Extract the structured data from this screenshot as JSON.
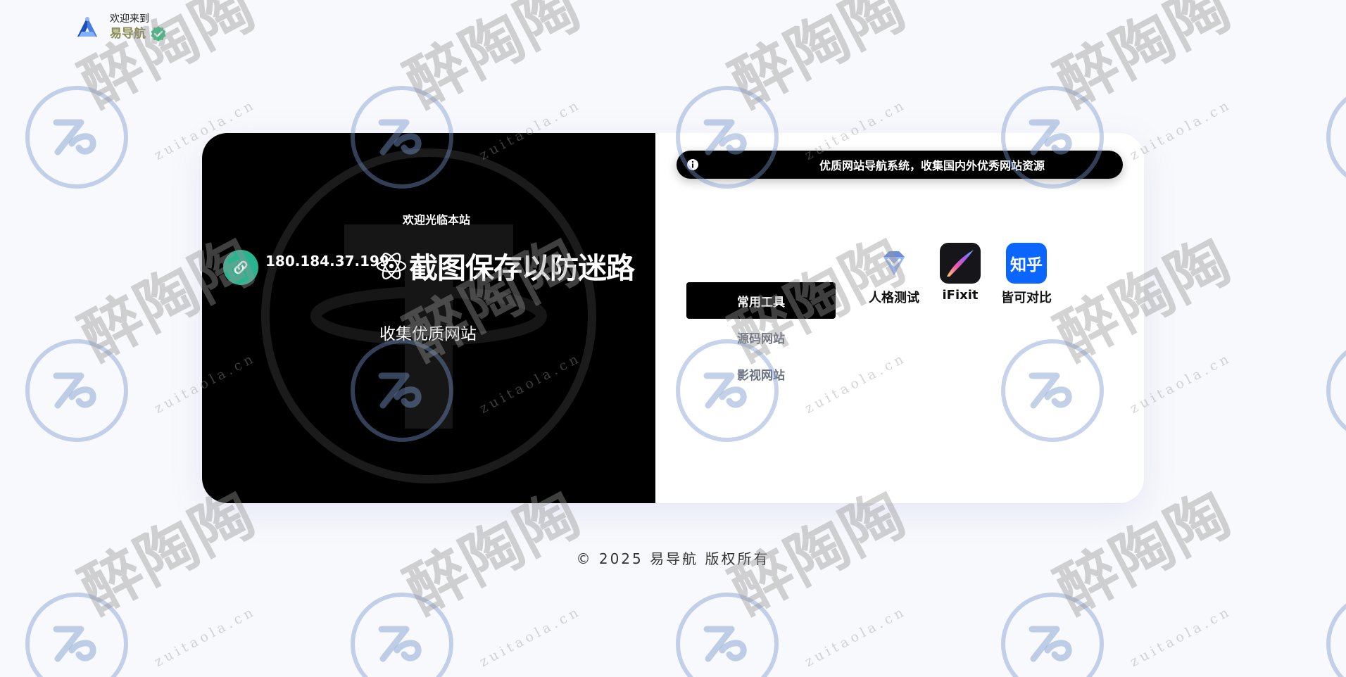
{
  "header": {
    "welcome": "欢迎来到",
    "brand": "易导航",
    "logo_icon": "triangle-a-logo-icon",
    "verified_icon": "check-badge-icon"
  },
  "hero": {
    "welcome": "欢迎光临本站",
    "ip": "180.184.37.199",
    "headline": "截图保存以防迷路",
    "tagline": "收集优质网站",
    "link_icon": "link-icon",
    "atom_icon": "atom-icon"
  },
  "notice": {
    "text": "优质网站导航系统，收集国内外优秀网站资源",
    "icon": "info-icon"
  },
  "categories": [
    {
      "label": "常用工具",
      "active": true
    },
    {
      "label": "源码网站",
      "active": false
    },
    {
      "label": "影视网站",
      "active": false
    }
  ],
  "apps": [
    {
      "label": "人格测试",
      "icon": "diamond-icon"
    },
    {
      "label": "iFixit",
      "icon": "brush-stroke-icon"
    },
    {
      "label": "皆可对比",
      "icon_text": "知乎"
    }
  ],
  "footer": {
    "copyright": "© 2025 易导航 版权所有"
  },
  "watermark": {
    "text": "醉陶陶",
    "sub": "zuitaola.cn"
  },
  "colors": {
    "accent_green": "#27b48e",
    "brand_olive": "#8a8a52",
    "zhihu_blue": "#0a66ff",
    "panel_black": "#000000"
  }
}
